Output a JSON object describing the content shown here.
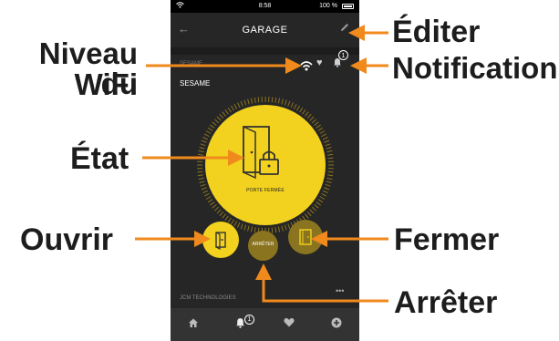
{
  "status_bar": {
    "time": "8:58",
    "battery": "100 %"
  },
  "nav": {
    "title": "GARAGE"
  },
  "device": {
    "small_label": "SESAME",
    "name": "SESAME",
    "notifications_count": "1",
    "state_label": "PORTE FERMÉE",
    "stop_label": "ARRÊTER",
    "footer": "JCM TECHNOLOGIES",
    "more": "•••"
  },
  "tabbar": {
    "notifications_count": "1"
  },
  "callouts": {
    "edit": "Éditer",
    "wifi_line1": "Niveau du",
    "wifi_line2": "WiFi",
    "notifications": "Notifications",
    "state": "État",
    "open": "Ouvrir",
    "close": "Fermer",
    "stop": "Arrêter"
  },
  "colors": {
    "accent": "#f2d21e",
    "accent_dim": "#8a7420",
    "arrow": "#f08a1c"
  }
}
